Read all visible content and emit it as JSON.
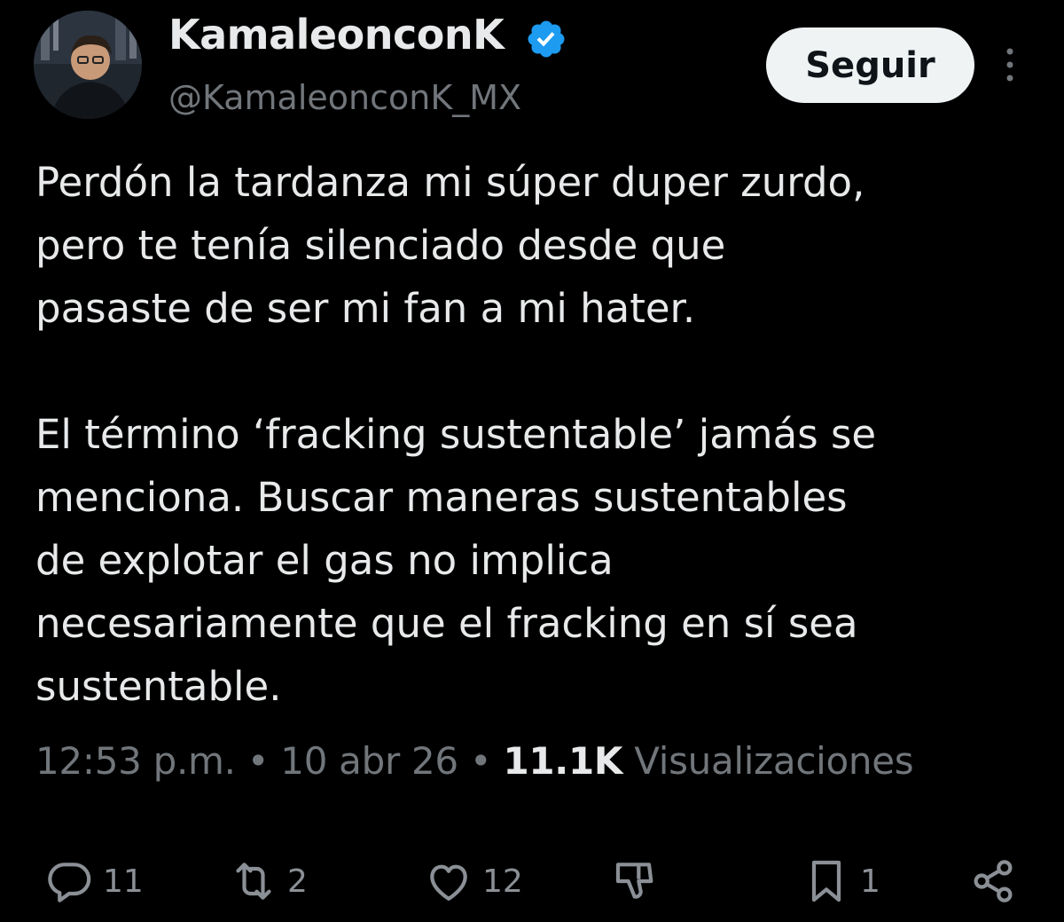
{
  "user": {
    "display_name": "KamaleonconK",
    "handle": "@KamaleonconK_MX",
    "verified": true,
    "verified_color": "#1d9bf0"
  },
  "header": {
    "follow_label": "Seguir"
  },
  "tweet": {
    "lines": [
      "Perdón la tardanza mi súper duper zurdo,",
      "pero te tenía silenciado desde que",
      "pasaste de ser mi fan a mi hater.",
      "El término ‘fracking sustentable’ jamás se",
      "menciona. Buscar maneras sustentables",
      "de explotar el gas no implica",
      "necesariamente que el fracking en sí sea",
      "sustentable."
    ]
  },
  "meta": {
    "time": "12:53 p.m.",
    "separator": "•",
    "date": "10 abr 26",
    "views_count": "11.1K",
    "views_label": "Visualizaciones"
  },
  "actions": {
    "replies": "11",
    "reposts": "2",
    "likes": "12",
    "bookmarks": "1"
  },
  "colors": {
    "background": "#000000",
    "text": "#e7e9ea",
    "secondary": "#71767b"
  }
}
